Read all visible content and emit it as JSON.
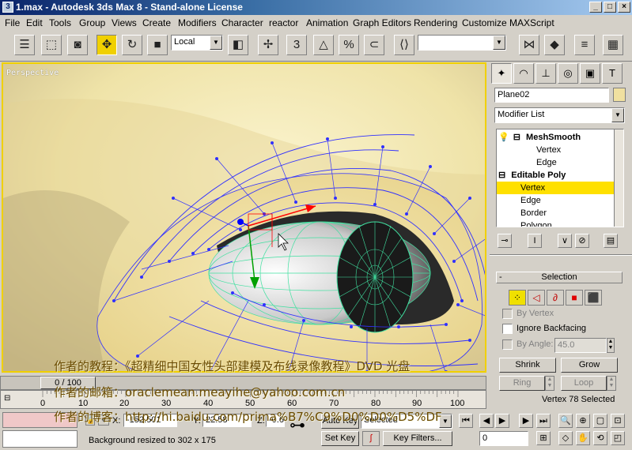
{
  "window": {
    "title": "1.max - Autodesk 3ds Max 8 - Stand-alone License",
    "btn_min": "_",
    "btn_max": "□",
    "btn_close": "×"
  },
  "menus": [
    "File",
    "Edit",
    "Tools",
    "Group",
    "Views",
    "Create",
    "Modifiers",
    "Character",
    "reactor",
    "Animation",
    "Graph Editors",
    "Rendering",
    "Customize",
    "MAXScript"
  ],
  "toolbar": {
    "coord_system": "Local",
    "snap_label": "3",
    "named_sel": ""
  },
  "viewport": {
    "label": "Perspective"
  },
  "cmd": {
    "object_name": "Plane02",
    "modifier_list": "Modifier List",
    "stack": [
      {
        "label": "MeshSmooth",
        "bold": true,
        "indent": 0
      },
      {
        "label": "Vertex",
        "bold": false,
        "indent": 1
      },
      {
        "label": "Edge",
        "bold": false,
        "indent": 1
      },
      {
        "label": "Editable Poly",
        "bold": true,
        "indent": 0
      },
      {
        "label": "Vertex",
        "bold": false,
        "indent": 1,
        "selected": true
      },
      {
        "label": "Edge",
        "bold": false,
        "indent": 1
      },
      {
        "label": "Border",
        "bold": false,
        "indent": 1
      },
      {
        "label": "Polygon",
        "bold": false,
        "indent": 1
      }
    ],
    "rollout_title": "Selection",
    "by_vertex": "By Vertex",
    "ignore_backfacing": "Ignore Backfacing",
    "by_angle": "By Angle:",
    "angle_value": "45.0",
    "shrink": "Shrink",
    "grow": "Grow",
    "ring": "Ring",
    "loop": "Loop",
    "status": "Vertex 78 Selected"
  },
  "timeline": {
    "slider": "0 / 100",
    "ticks": [
      "0",
      "10",
      "20",
      "30",
      "40",
      "50",
      "60",
      "70",
      "80",
      "90",
      "100"
    ]
  },
  "status": {
    "x_label": "X:",
    "x_value": "-152.501",
    "y_label": "Y:",
    "y_value": "22.58",
    "z_label": "Z:",
    "z_value": "-0.6",
    "message": "Background resized to 302 x 175",
    "auto_key": "Auto Key",
    "selected": "Selected",
    "set_key": "Set Key",
    "key_filters": "Key Filters...",
    "frame": "0"
  },
  "overlay": {
    "line1": "作者的教程：《超精细中国女性头部建模及布线录像教程》DVD 光盘",
    "line2": "作者的邮箱：oraclemean.meayihe@yahoo.com.cn",
    "line3": "作者的博客：http://hi.baidu.com/prima%B7%C9%D0%D0%D5%DF"
  },
  "colors": {
    "accent": "#f0d000",
    "wire": "#3030ff",
    "iris": "#40e0a0"
  }
}
